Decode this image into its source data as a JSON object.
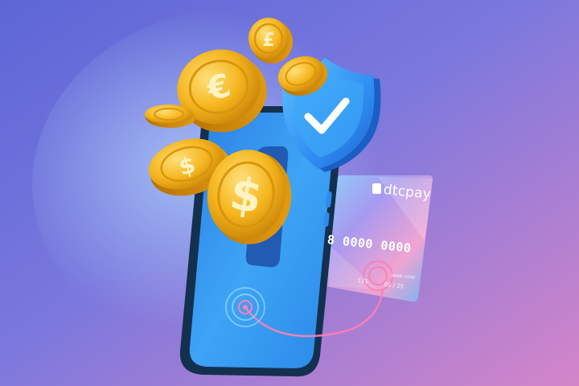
{
  "card": {
    "brand": "dtcpay",
    "number": "8 0000 0000",
    "cvv": "121",
    "expiry": "05 / 25",
    "holder": "NAME HERE"
  },
  "icons": [
    "euro-coin",
    "pound-coin",
    "dollar-coin",
    "shield-check",
    "fingerprint",
    "credit-card",
    "smartphone"
  ],
  "colors": {
    "background_left": "#6e6fdc",
    "background_right": "#d882c9",
    "phone_screen": "#3a9bf0",
    "coin_gold": "#f6b820",
    "shield_blue": "#2d8ff0"
  }
}
